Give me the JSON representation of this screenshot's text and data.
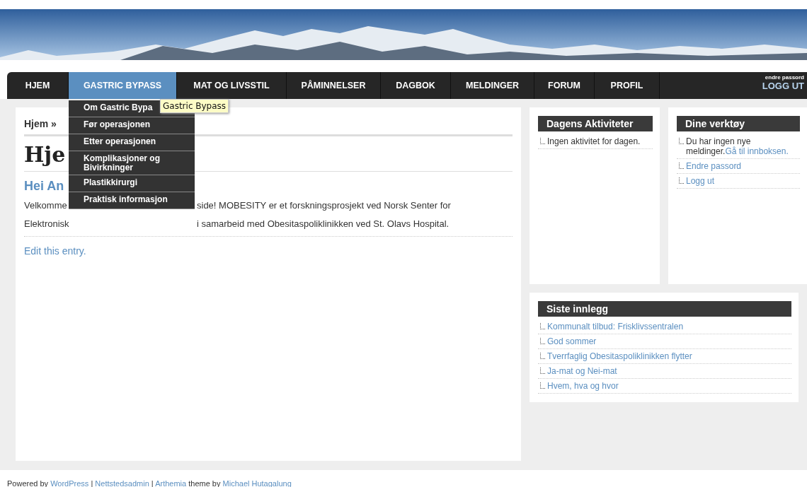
{
  "nav": {
    "items": [
      {
        "label": "HJEM",
        "selected": false
      },
      {
        "label": "GASTRIC BYPASS",
        "selected": true
      },
      {
        "label": "MAT OG LIVSSTIL",
        "selected": false
      },
      {
        "label": "PÅMINNELSER",
        "selected": false
      },
      {
        "label": "DAGBOK",
        "selected": false
      },
      {
        "label": "MELDINGER",
        "selected": false
      },
      {
        "label": "FORUM",
        "selected": false
      },
      {
        "label": "PROFIL",
        "selected": false
      }
    ],
    "user_link": "endre passord",
    "logout": "LOGG UT"
  },
  "dropdown": {
    "items": [
      "Om Gastric Bypa",
      "Før operasjonen",
      "Etter operasjonen",
      "Komplikasjoner og Bivirkninger",
      "Plastikkirurgi",
      "Praktisk informasjon"
    ]
  },
  "tooltip": "Gastric Bypass",
  "main": {
    "breadcrumb": "Hjem »",
    "title": "Hje",
    "greeting": "Hei An",
    "paragraph_lines": [
      [
        "Velkomme",
        "side! MOBESITY er et forskningsprosjekt ved Norsk Senter for"
      ],
      [
        "Elektronisk",
        "i samarbeid med Obesitaspoliklinikken ved St. Olavs Hospital."
      ]
    ],
    "edit_link": "Edit this entry."
  },
  "widgets": {
    "activities": {
      "title": "Dagens Aktiviteter",
      "items": [
        "Ingen aktivitet for dagen."
      ]
    },
    "tools": {
      "title": "Dine verktøy",
      "message": "Du har ingen nye meldinger.",
      "inbox_link": "Gå til innboksen.",
      "links": [
        "Endre passord",
        "Logg ut"
      ]
    },
    "recent": {
      "title": "Siste innlegg",
      "items": [
        "Kommunalt tilbud: Frisklivssentralen",
        "God sommer",
        "Tverrfaglig Obesitaspoliklinikken flytter",
        "Ja-mat og Nei-mat",
        "Hvem, hva og hvor"
      ]
    }
  },
  "footer": [
    {
      "text": "Powered by ",
      "link": false
    },
    {
      "text": "WordPress",
      "link": true
    },
    {
      "text": " | ",
      "link": false
    },
    {
      "text": "Nettstedsadmin",
      "link": true
    },
    {
      "text": " | ",
      "link": false
    },
    {
      "text": "Arthemia",
      "link": true
    },
    {
      "text": " theme by ",
      "link": false
    },
    {
      "text": "Michael Hutagalung",
      "link": true
    }
  ]
}
